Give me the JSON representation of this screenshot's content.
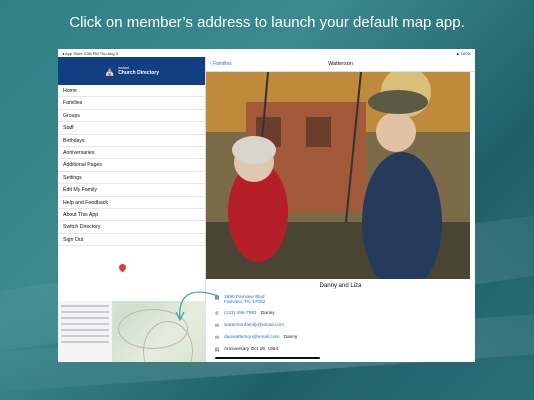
{
  "headline": "Click on member’s address to launch your default map app.",
  "status": {
    "left": "◂ App Store   2:56 PM   Thu Aug 5",
    "right": "▲ 100%"
  },
  "app": {
    "logo_small": "Instant",
    "logo_name": "Church Directory"
  },
  "sidebar": {
    "items": [
      {
        "label": "Home"
      },
      {
        "label": "Families"
      },
      {
        "label": "Groups"
      },
      {
        "label": "Staff"
      },
      {
        "label": "Birthdays"
      },
      {
        "label": "Anniversaries"
      },
      {
        "label": "Additional Pages"
      },
      {
        "label": "Settings"
      },
      {
        "label": "Edit My Family"
      },
      {
        "label": "Help and Feedback"
      },
      {
        "label": "About This App"
      },
      {
        "label": "Switch Directory"
      },
      {
        "label": "Sign Out"
      }
    ]
  },
  "navbar": {
    "back_label": "Families",
    "title": "Watterson"
  },
  "family": {
    "names": "Danny and Liza",
    "address": "1890 Fairview Blvd\nFairview, TN 37062",
    "phone": "(123) 456-7891",
    "phone_name": "Danny",
    "family_email": "wattersonfamily@email.com",
    "personal_email": "danwatterson@email.com",
    "personal_email_name": "Danny",
    "anniversary": "Anniversary Oct 29, 1964"
  },
  "colors": {
    "brand": "#123f82",
    "link": "#1a73e8",
    "pin": "#e03b2e"
  },
  "icons": {
    "address": "map-icon",
    "phone": "phone-icon",
    "email": "envelope-icon",
    "anniversary": "calendar-icon",
    "back": "chevron-left-icon"
  }
}
